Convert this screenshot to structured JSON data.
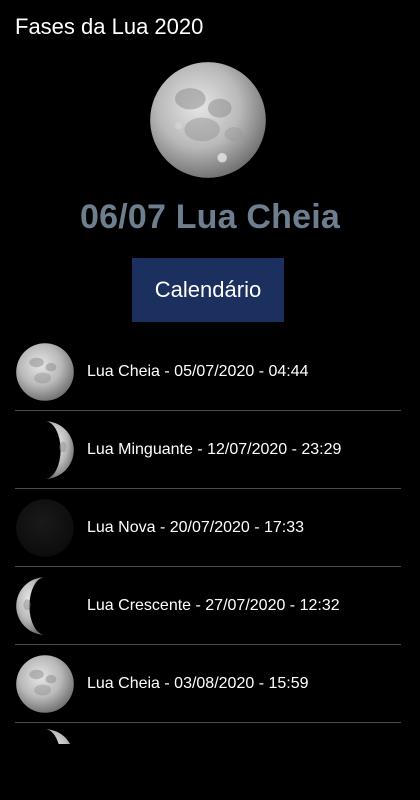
{
  "app": {
    "title": "Fases da Lua 2020"
  },
  "hero": {
    "moon_icon": "full-moon-icon",
    "date_phase": "06/07 Lua Cheia"
  },
  "calendar_button": {
    "label": "Calendário"
  },
  "phases": [
    {
      "label": "Lua Cheia - 05/07/2020 - 04:44",
      "icon": "full-moon-icon"
    },
    {
      "label": "Lua Minguante - 12/07/2020 - 23:29",
      "icon": "waning-moon-icon"
    },
    {
      "label": "Lua Nova - 20/07/2020 - 17:33",
      "icon": "new-moon-icon"
    },
    {
      "label": "Lua Crescente - 27/07/2020 - 12:32",
      "icon": "waxing-moon-icon"
    },
    {
      "label": "Lua Cheia - 03/08/2020 - 15:59",
      "icon": "full-moon-icon"
    }
  ],
  "colors": {
    "background": "#000000",
    "hero_date_text": "#6d7f8f",
    "button_bg": "#1c3060",
    "divider": "#4a4a4a"
  }
}
